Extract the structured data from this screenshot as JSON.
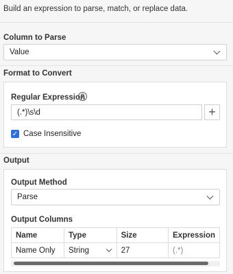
{
  "description": "Build an expression to parse, match, or replace data.",
  "column_to_parse": {
    "label": "Column to Parse",
    "value": "Value"
  },
  "format_to_convert": {
    "label": "Format to Convert",
    "regex_label": "Regular Expression",
    "help_icon": "?",
    "regex_value": "(.*)\\s\\d",
    "add_button": "+",
    "case_insensitive_label": "Case Insensitive",
    "case_insensitive_checked": true
  },
  "output": {
    "label": "Output",
    "method_label": "Output Method",
    "method_value": "Parse",
    "columns_label": "Output Columns",
    "table": {
      "headers": [
        "Name",
        "Type",
        "Size",
        "Expression"
      ],
      "rows": [
        [
          "Name Only",
          "String",
          "27",
          "(.*)"
        ]
      ]
    }
  },
  "colors": {
    "accent": "#2f6fd6",
    "background": "#f6f6f6"
  }
}
